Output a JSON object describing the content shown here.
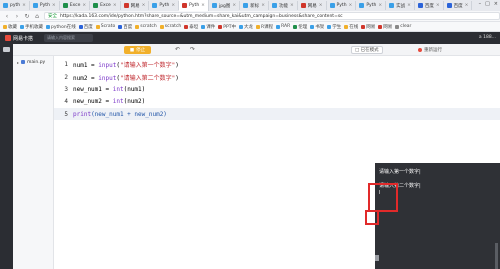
{
  "browser": {
    "tabs": [
      {
        "label": "pyth",
        "color": "#3aa0e8",
        "active": false
      },
      {
        "label": "Pyth",
        "color": "#3aa0e8",
        "active": false
      },
      {
        "label": "Exce",
        "color": "#1f8f4a",
        "active": false
      },
      {
        "label": "Exce",
        "color": "#1f8f4a",
        "active": false
      },
      {
        "label": "网易",
        "color": "#d0362b",
        "active": false
      },
      {
        "label": "Pyth",
        "color": "#3aa0e8",
        "active": false
      },
      {
        "label": "Pyth",
        "color": "#d0362b",
        "active": true
      },
      {
        "label": "jpg图",
        "color": "#3aa0e8",
        "active": false
      },
      {
        "label": "新标",
        "color": "#3aa0e8",
        "active": false
      },
      {
        "label": "功能",
        "color": "#3aa0e8",
        "active": false
      },
      {
        "label": "网易",
        "color": "#d0362b",
        "active": false
      },
      {
        "label": "Pyth",
        "color": "#3aa0e8",
        "active": false
      },
      {
        "label": "Pyth",
        "color": "#3aa0e8",
        "active": false
      },
      {
        "label": "实战",
        "color": "#3aa0e8",
        "active": false
      },
      {
        "label": "百度",
        "color": "#2b63d9",
        "active": false
      },
      {
        "label": "百度",
        "color": "#2b63d9",
        "active": false
      }
    ],
    "url_prefix": "安全",
    "url": "https://kada.163.com/ide/python.htm?share_source=&utm_medium=share_kai&utm_campaign=business&share_content=sc",
    "bookmarks": [
      "收藏",
      "手机收藏",
      "python在线",
      "百度",
      "Scrato",
      "百度",
      "scratch",
      "scratch",
      "泰坦",
      "课件",
      "PPT中",
      "大龙",
      "R课程",
      "RAR",
      "伦理",
      "书架",
      "学生",
      "在线",
      "网易",
      "网易",
      "clear"
    ]
  },
  "app": {
    "brand": "网易卡搭",
    "search_placeholder": "请输入内容搜索",
    "user": "a 188..."
  },
  "toolbar": {
    "run_label": "停止",
    "exec_mode": "□ 已在模式",
    "reset": "重新运行"
  },
  "files": {
    "name": "main.py"
  },
  "editor": {
    "tab_label": "未命名",
    "lines": [
      {
        "num": "1",
        "text": "num1 = input(\"请输入第一个数字\")"
      },
      {
        "num": "2",
        "text": "num2 = input(\"请输入第二个数字\")"
      },
      {
        "num": "3",
        "text": "new_num1 = int(num1)"
      },
      {
        "num": "4",
        "text": "new_num2 = int(num2)"
      },
      {
        "num": "5",
        "text": "print(new_num1 + new_num2)"
      }
    ]
  },
  "console": {
    "lines": [
      "请输入第一个数字|",
      "请输入第二个数字|"
    ],
    "cursor": "I"
  }
}
